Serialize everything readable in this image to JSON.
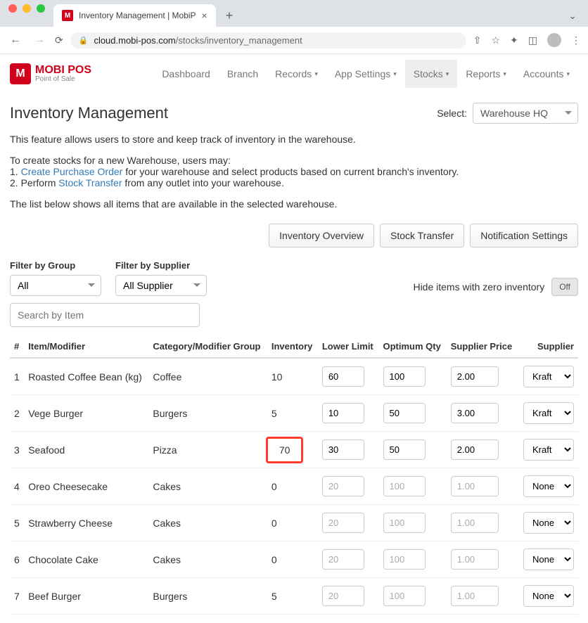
{
  "browser": {
    "tab_title": "Inventory Management | MobiP",
    "url_host": "cloud.mobi-pos.com",
    "url_path": "/stocks/inventory_management"
  },
  "logo": {
    "badge": "M",
    "main": "MOBI POS",
    "sub": "Point of Sale"
  },
  "nav": {
    "items": [
      {
        "label": "Dashboard",
        "dropdown": false
      },
      {
        "label": "Branch",
        "dropdown": false
      },
      {
        "label": "Records",
        "dropdown": true
      },
      {
        "label": "App Settings",
        "dropdown": true
      },
      {
        "label": "Stocks",
        "dropdown": true,
        "active": true
      },
      {
        "label": "Reports",
        "dropdown": true
      },
      {
        "label": "Accounts",
        "dropdown": true
      }
    ]
  },
  "page": {
    "title": "Inventory Management",
    "select_label": "Select:",
    "warehouse": "Warehouse HQ",
    "intro1": "This feature allows users to store and keep track of inventory in the warehouse.",
    "intro2": "To create stocks for a new Warehouse, users may:",
    "step1_prefix": "1. ",
    "step1_link": "Create Purchase Order",
    "step1_suffix": " for your warehouse and select products based on current branch's inventory.",
    "step2_prefix": "2. Perform ",
    "step2_link": "Stock Transfer",
    "step2_suffix": " from any outlet into your warehouse.",
    "intro3": "The list below shows all items that are available in the selected warehouse."
  },
  "actions": {
    "inventory_overview": "Inventory Overview",
    "stock_transfer": "Stock Transfer",
    "notification_settings": "Notification Settings"
  },
  "filters": {
    "group_label": "Filter by Group",
    "group_value": "All",
    "supplier_label": "Filter by Supplier",
    "supplier_value": "All Supplier",
    "hide_zero_label": "Hide items with zero inventory",
    "toggle_off": "Off",
    "search_placeholder": "Search by Item"
  },
  "table": {
    "headers": {
      "num": "#",
      "item": "Item/Modifier",
      "category": "Category/Modifier Group",
      "inventory": "Inventory",
      "lower": "Lower Limit",
      "optimum": "Optimum Qty",
      "price": "Supplier Price",
      "supplier": "Supplier"
    },
    "rows": [
      {
        "num": "1",
        "item": "Roasted Coffee Bean (kg)",
        "category": "Coffee",
        "inventory": "10",
        "lower": "60",
        "optimum": "100",
        "price": "2.00",
        "supplier": "Kraft",
        "enabled": true
      },
      {
        "num": "2",
        "item": "Vege Burger",
        "category": "Burgers",
        "inventory": "5",
        "lower": "10",
        "optimum": "50",
        "price": "3.00",
        "supplier": "Kraft",
        "enabled": true
      },
      {
        "num": "3",
        "item": "Seafood",
        "category": "Pizza",
        "inventory": "70",
        "lower": "30",
        "optimum": "50",
        "price": "2.00",
        "supplier": "Kraft",
        "enabled": true,
        "highlight": true
      },
      {
        "num": "4",
        "item": "Oreo Cheesecake",
        "category": "Cakes",
        "inventory": "0",
        "lower": "20",
        "optimum": "100",
        "price": "1.00",
        "supplier": "None",
        "enabled": false
      },
      {
        "num": "5",
        "item": "Strawberry Cheese",
        "category": "Cakes",
        "inventory": "0",
        "lower": "20",
        "optimum": "100",
        "price": "1.00",
        "supplier": "None",
        "enabled": false
      },
      {
        "num": "6",
        "item": "Chocolate Cake",
        "category": "Cakes",
        "inventory": "0",
        "lower": "20",
        "optimum": "100",
        "price": "1.00",
        "supplier": "None",
        "enabled": false
      },
      {
        "num": "7",
        "item": "Beef Burger",
        "category": "Burgers",
        "inventory": "5",
        "lower": "20",
        "optimum": "100",
        "price": "1.00",
        "supplier": "None",
        "enabled": false
      }
    ]
  }
}
